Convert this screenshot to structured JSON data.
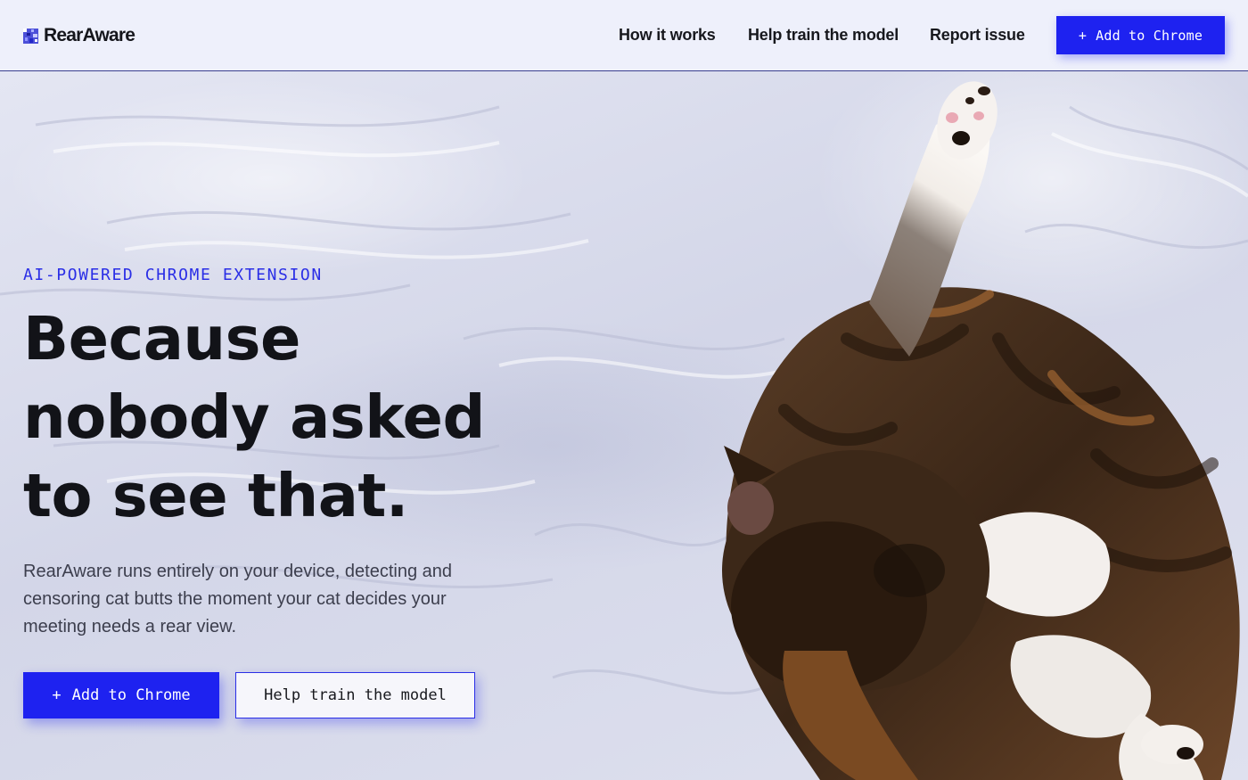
{
  "brand": {
    "name": "RearAware",
    "logo_icon": "pixel-cat-icon",
    "accent_color": "#1e22f0"
  },
  "nav": {
    "links": [
      "How it works",
      "Help train the model",
      "Report issue"
    ],
    "cta_icon": "+",
    "cta_label": "Add to Chrome"
  },
  "hero": {
    "eyebrow": "AI-POWERED CHROME EXTENSION",
    "headline_lines": [
      "Because",
      "nobody asked",
      "to see that."
    ],
    "subcopy": "RearAware runs entirely on your device, detecting and censoring cat butts the moment your cat decides your meeting needs a rear view.",
    "primary_icon": "+",
    "primary_label": "Add to Chrome",
    "secondary_label": "Help train the model",
    "image": "photo of a tabby-and-white cat grooming on white bedsheets, one leg raised"
  }
}
